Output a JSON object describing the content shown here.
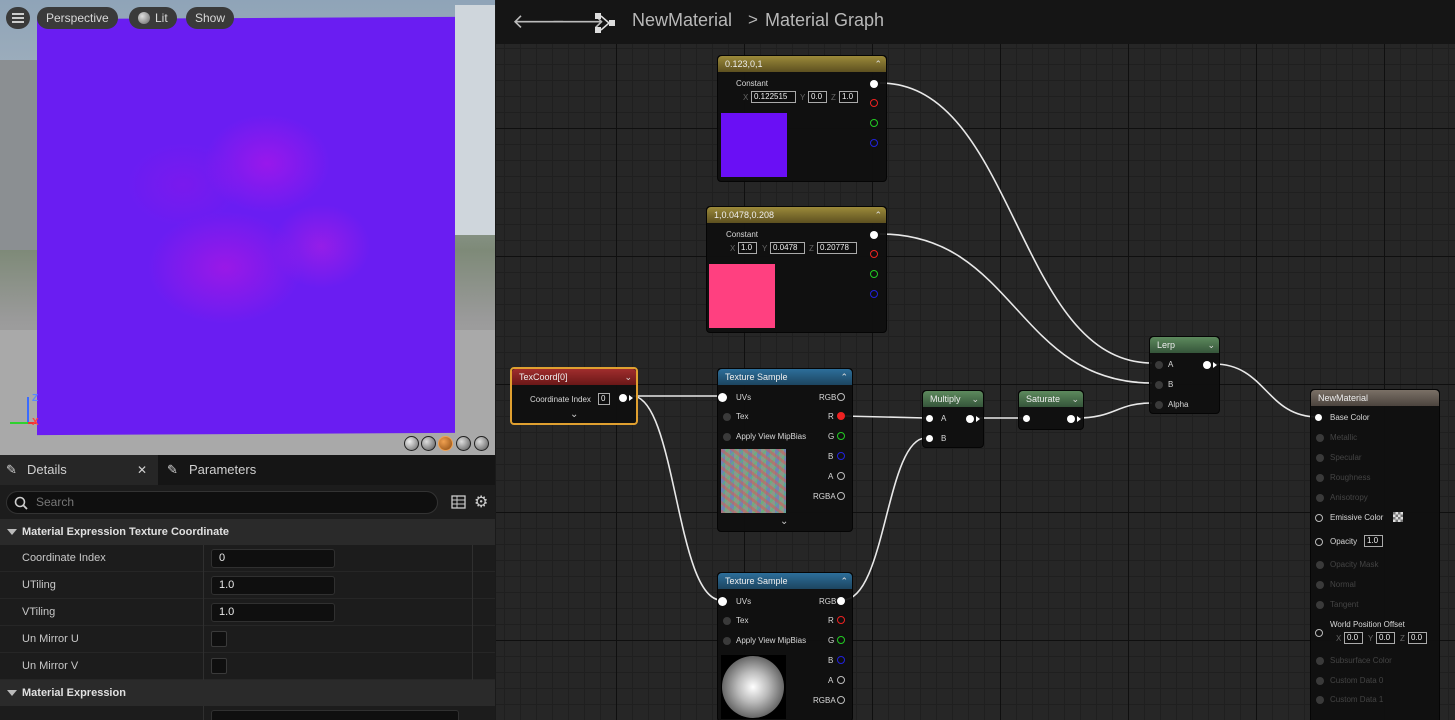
{
  "viewport": {
    "buttons": {
      "perspective": "Perspective",
      "lit": "Lit",
      "show": "Show"
    },
    "axes": {
      "z": "Z",
      "x": "X"
    },
    "preview_color": "#6a1df2"
  },
  "details": {
    "tabs": {
      "details": "Details",
      "parameters": "Parameters"
    },
    "search_placeholder": "Search",
    "section1": "Material Expression Texture Coordinate",
    "props": [
      {
        "label": "Coordinate Index",
        "value": "0"
      },
      {
        "label": "UTiling",
        "value": "1.0"
      },
      {
        "label": "VTiling",
        "value": "1.0"
      },
      {
        "label": "Un Mirror U"
      },
      {
        "label": "Un Mirror V"
      }
    ],
    "section2": "Material Expression"
  },
  "graph": {
    "breadcrumb": {
      "asset": "NewMaterial",
      "sep": ">",
      "graph": "Material Graph"
    },
    "const1": {
      "title": "0.123,0,1",
      "label": "Constant",
      "x_label": "X",
      "x": "0.122515",
      "y_label": "Y",
      "y": "0.0",
      "z_label": "Z",
      "z": "1.0",
      "color": "#6a0ff5"
    },
    "const2": {
      "title": "1,0.0478,0.208",
      "label": "Constant",
      "x_label": "X",
      "x": "1.0",
      "y_label": "Y",
      "y": "0.0478",
      "z_label": "Z",
      "z": "0.20778",
      "color": "#ff4080"
    },
    "texcoord": {
      "title": "TexCoord[0]",
      "label": "Coordinate Index",
      "value": "0"
    },
    "tex1": {
      "title": "Texture Sample",
      "inputs": [
        "UVs",
        "Tex",
        "Apply View MipBias"
      ],
      "outputs": [
        "RGB",
        "R",
        "G",
        "B",
        "A",
        "RGBA"
      ]
    },
    "tex2": {
      "title": "Texture Sample",
      "inputs": [
        "UVs",
        "Tex",
        "Apply View MipBias"
      ],
      "outputs": [
        "RGB",
        "R",
        "G",
        "B",
        "A",
        "RGBA"
      ]
    },
    "multiply": {
      "title": "Multiply",
      "a": "A",
      "b": "B"
    },
    "saturate": {
      "title": "Saturate"
    },
    "lerp": {
      "title": "Lerp",
      "a": "A",
      "b": "B",
      "alpha": "Alpha"
    },
    "result": {
      "title": "NewMaterial",
      "pins": [
        "Base Color",
        "Metallic",
        "Specular",
        "Roughness",
        "Anisotropy",
        "Emissive Color",
        "Opacity",
        "Opacity Mask",
        "Normal",
        "Tangent",
        "World Position Offset",
        "Subsurface Color",
        "Custom Data 0",
        "Custom Data 1"
      ],
      "opacity_value": "1.0",
      "wpo": {
        "x_label": "X",
        "x": "0.0",
        "y_label": "Y",
        "y": "0.0",
        "z_label": "Z",
        "z": "0.0"
      }
    }
  }
}
